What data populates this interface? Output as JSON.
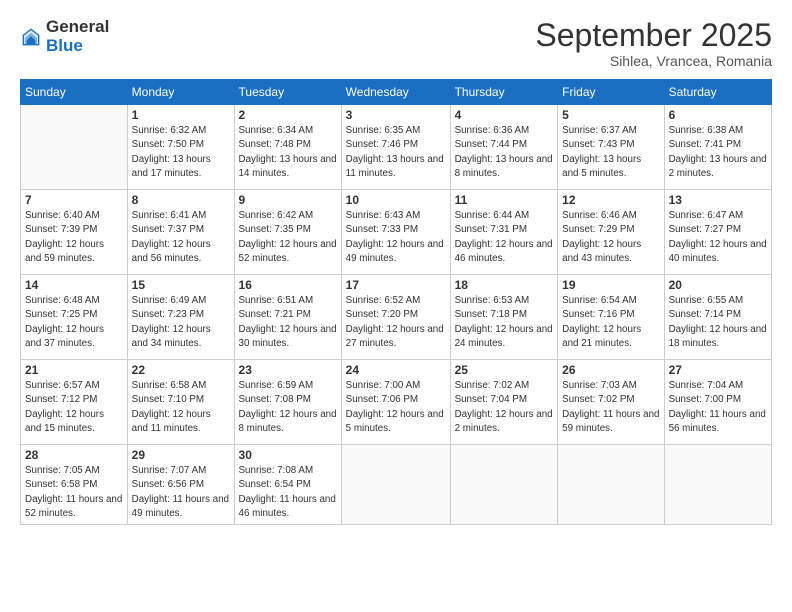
{
  "header": {
    "logo_general": "General",
    "logo_blue": "Blue",
    "month_title": "September 2025",
    "location": "Sihlea, Vrancea, Romania"
  },
  "calendar": {
    "days_of_week": [
      "Sunday",
      "Monday",
      "Tuesday",
      "Wednesday",
      "Thursday",
      "Friday",
      "Saturday"
    ],
    "weeks": [
      [
        {
          "day": "",
          "info": ""
        },
        {
          "day": "1",
          "info": "Sunrise: 6:32 AM\nSunset: 7:50 PM\nDaylight: 13 hours\nand 17 minutes."
        },
        {
          "day": "2",
          "info": "Sunrise: 6:34 AM\nSunset: 7:48 PM\nDaylight: 13 hours\nand 14 minutes."
        },
        {
          "day": "3",
          "info": "Sunrise: 6:35 AM\nSunset: 7:46 PM\nDaylight: 13 hours\nand 11 minutes."
        },
        {
          "day": "4",
          "info": "Sunrise: 6:36 AM\nSunset: 7:44 PM\nDaylight: 13 hours\nand 8 minutes."
        },
        {
          "day": "5",
          "info": "Sunrise: 6:37 AM\nSunset: 7:43 PM\nDaylight: 13 hours\nand 5 minutes."
        },
        {
          "day": "6",
          "info": "Sunrise: 6:38 AM\nSunset: 7:41 PM\nDaylight: 13 hours\nand 2 minutes."
        }
      ],
      [
        {
          "day": "7",
          "info": "Sunrise: 6:40 AM\nSunset: 7:39 PM\nDaylight: 12 hours\nand 59 minutes."
        },
        {
          "day": "8",
          "info": "Sunrise: 6:41 AM\nSunset: 7:37 PM\nDaylight: 12 hours\nand 56 minutes."
        },
        {
          "day": "9",
          "info": "Sunrise: 6:42 AM\nSunset: 7:35 PM\nDaylight: 12 hours\nand 52 minutes."
        },
        {
          "day": "10",
          "info": "Sunrise: 6:43 AM\nSunset: 7:33 PM\nDaylight: 12 hours\nand 49 minutes."
        },
        {
          "day": "11",
          "info": "Sunrise: 6:44 AM\nSunset: 7:31 PM\nDaylight: 12 hours\nand 46 minutes."
        },
        {
          "day": "12",
          "info": "Sunrise: 6:46 AM\nSunset: 7:29 PM\nDaylight: 12 hours\nand 43 minutes."
        },
        {
          "day": "13",
          "info": "Sunrise: 6:47 AM\nSunset: 7:27 PM\nDaylight: 12 hours\nand 40 minutes."
        }
      ],
      [
        {
          "day": "14",
          "info": "Sunrise: 6:48 AM\nSunset: 7:25 PM\nDaylight: 12 hours\nand 37 minutes."
        },
        {
          "day": "15",
          "info": "Sunrise: 6:49 AM\nSunset: 7:23 PM\nDaylight: 12 hours\nand 34 minutes."
        },
        {
          "day": "16",
          "info": "Sunrise: 6:51 AM\nSunset: 7:21 PM\nDaylight: 12 hours\nand 30 minutes."
        },
        {
          "day": "17",
          "info": "Sunrise: 6:52 AM\nSunset: 7:20 PM\nDaylight: 12 hours\nand 27 minutes."
        },
        {
          "day": "18",
          "info": "Sunrise: 6:53 AM\nSunset: 7:18 PM\nDaylight: 12 hours\nand 24 minutes."
        },
        {
          "day": "19",
          "info": "Sunrise: 6:54 AM\nSunset: 7:16 PM\nDaylight: 12 hours\nand 21 minutes."
        },
        {
          "day": "20",
          "info": "Sunrise: 6:55 AM\nSunset: 7:14 PM\nDaylight: 12 hours\nand 18 minutes."
        }
      ],
      [
        {
          "day": "21",
          "info": "Sunrise: 6:57 AM\nSunset: 7:12 PM\nDaylight: 12 hours\nand 15 minutes."
        },
        {
          "day": "22",
          "info": "Sunrise: 6:58 AM\nSunset: 7:10 PM\nDaylight: 12 hours\nand 11 minutes."
        },
        {
          "day": "23",
          "info": "Sunrise: 6:59 AM\nSunset: 7:08 PM\nDaylight: 12 hours\nand 8 minutes."
        },
        {
          "day": "24",
          "info": "Sunrise: 7:00 AM\nSunset: 7:06 PM\nDaylight: 12 hours\nand 5 minutes."
        },
        {
          "day": "25",
          "info": "Sunrise: 7:02 AM\nSunset: 7:04 PM\nDaylight: 12 hours\nand 2 minutes."
        },
        {
          "day": "26",
          "info": "Sunrise: 7:03 AM\nSunset: 7:02 PM\nDaylight: 11 hours\nand 59 minutes."
        },
        {
          "day": "27",
          "info": "Sunrise: 7:04 AM\nSunset: 7:00 PM\nDaylight: 11 hours\nand 56 minutes."
        }
      ],
      [
        {
          "day": "28",
          "info": "Sunrise: 7:05 AM\nSunset: 6:58 PM\nDaylight: 11 hours\nand 52 minutes."
        },
        {
          "day": "29",
          "info": "Sunrise: 7:07 AM\nSunset: 6:56 PM\nDaylight: 11 hours\nand 49 minutes."
        },
        {
          "day": "30",
          "info": "Sunrise: 7:08 AM\nSunset: 6:54 PM\nDaylight: 11 hours\nand 46 minutes."
        },
        {
          "day": "",
          "info": ""
        },
        {
          "day": "",
          "info": ""
        },
        {
          "day": "",
          "info": ""
        },
        {
          "day": "",
          "info": ""
        }
      ]
    ]
  }
}
